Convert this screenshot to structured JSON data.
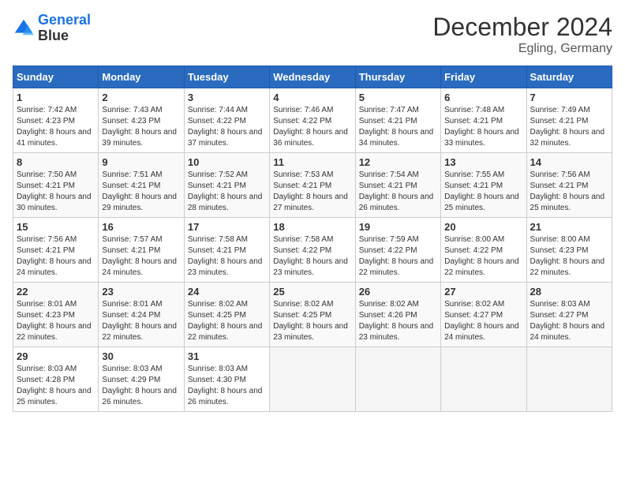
{
  "header": {
    "logo_line1": "General",
    "logo_line2": "Blue",
    "month": "December 2024",
    "location": "Egling, Germany"
  },
  "weekdays": [
    "Sunday",
    "Monday",
    "Tuesday",
    "Wednesday",
    "Thursday",
    "Friday",
    "Saturday"
  ],
  "weeks": [
    [
      {
        "day": "1",
        "rise": "7:42 AM",
        "set": "4:23 PM",
        "daylight": "8 hours and 41 minutes."
      },
      {
        "day": "2",
        "rise": "7:43 AM",
        "set": "4:23 PM",
        "daylight": "8 hours and 39 minutes."
      },
      {
        "day": "3",
        "rise": "7:44 AM",
        "set": "4:22 PM",
        "daylight": "8 hours and 37 minutes."
      },
      {
        "day": "4",
        "rise": "7:46 AM",
        "set": "4:22 PM",
        "daylight": "8 hours and 36 minutes."
      },
      {
        "day": "5",
        "rise": "7:47 AM",
        "set": "4:21 PM",
        "daylight": "8 hours and 34 minutes."
      },
      {
        "day": "6",
        "rise": "7:48 AM",
        "set": "4:21 PM",
        "daylight": "8 hours and 33 minutes."
      },
      {
        "day": "7",
        "rise": "7:49 AM",
        "set": "4:21 PM",
        "daylight": "8 hours and 32 minutes."
      }
    ],
    [
      {
        "day": "8",
        "rise": "7:50 AM",
        "set": "4:21 PM",
        "daylight": "8 hours and 30 minutes."
      },
      {
        "day": "9",
        "rise": "7:51 AM",
        "set": "4:21 PM",
        "daylight": "8 hours and 29 minutes."
      },
      {
        "day": "10",
        "rise": "7:52 AM",
        "set": "4:21 PM",
        "daylight": "8 hours and 28 minutes."
      },
      {
        "day": "11",
        "rise": "7:53 AM",
        "set": "4:21 PM",
        "daylight": "8 hours and 27 minutes."
      },
      {
        "day": "12",
        "rise": "7:54 AM",
        "set": "4:21 PM",
        "daylight": "8 hours and 26 minutes."
      },
      {
        "day": "13",
        "rise": "7:55 AM",
        "set": "4:21 PM",
        "daylight": "8 hours and 25 minutes."
      },
      {
        "day": "14",
        "rise": "7:56 AM",
        "set": "4:21 PM",
        "daylight": "8 hours and 25 minutes."
      }
    ],
    [
      {
        "day": "15",
        "rise": "7:56 AM",
        "set": "4:21 PM",
        "daylight": "8 hours and 24 minutes."
      },
      {
        "day": "16",
        "rise": "7:57 AM",
        "set": "4:21 PM",
        "daylight": "8 hours and 24 minutes."
      },
      {
        "day": "17",
        "rise": "7:58 AM",
        "set": "4:21 PM",
        "daylight": "8 hours and 23 minutes."
      },
      {
        "day": "18",
        "rise": "7:58 AM",
        "set": "4:22 PM",
        "daylight": "8 hours and 23 minutes."
      },
      {
        "day": "19",
        "rise": "7:59 AM",
        "set": "4:22 PM",
        "daylight": "8 hours and 22 minutes."
      },
      {
        "day": "20",
        "rise": "8:00 AM",
        "set": "4:22 PM",
        "daylight": "8 hours and 22 minutes."
      },
      {
        "day": "21",
        "rise": "8:00 AM",
        "set": "4:23 PM",
        "daylight": "8 hours and 22 minutes."
      }
    ],
    [
      {
        "day": "22",
        "rise": "8:01 AM",
        "set": "4:23 PM",
        "daylight": "8 hours and 22 minutes."
      },
      {
        "day": "23",
        "rise": "8:01 AM",
        "set": "4:24 PM",
        "daylight": "8 hours and 22 minutes."
      },
      {
        "day": "24",
        "rise": "8:02 AM",
        "set": "4:25 PM",
        "daylight": "8 hours and 22 minutes."
      },
      {
        "day": "25",
        "rise": "8:02 AM",
        "set": "4:25 PM",
        "daylight": "8 hours and 23 minutes."
      },
      {
        "day": "26",
        "rise": "8:02 AM",
        "set": "4:26 PM",
        "daylight": "8 hours and 23 minutes."
      },
      {
        "day": "27",
        "rise": "8:02 AM",
        "set": "4:27 PM",
        "daylight": "8 hours and 24 minutes."
      },
      {
        "day": "28",
        "rise": "8:03 AM",
        "set": "4:27 PM",
        "daylight": "8 hours and 24 minutes."
      }
    ],
    [
      {
        "day": "29",
        "rise": "8:03 AM",
        "set": "4:28 PM",
        "daylight": "8 hours and 25 minutes."
      },
      {
        "day": "30",
        "rise": "8:03 AM",
        "set": "4:29 PM",
        "daylight": "8 hours and 26 minutes."
      },
      {
        "day": "31",
        "rise": "8:03 AM",
        "set": "4:30 PM",
        "daylight": "8 hours and 26 minutes."
      },
      null,
      null,
      null,
      null
    ]
  ]
}
